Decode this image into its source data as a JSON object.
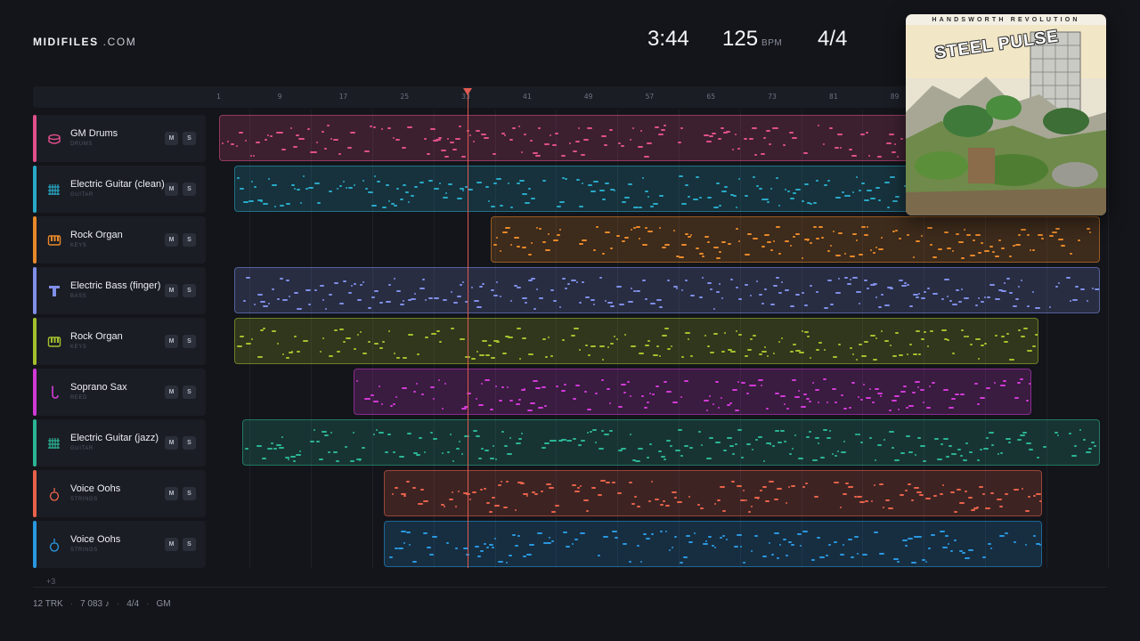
{
  "header": {
    "logo_bold": "MIDIFILES",
    "logo_light": ".COM",
    "duration": "3:44",
    "tempo": "125",
    "tempo_unit": "BPM",
    "time_signature": "4/4"
  },
  "album": {
    "title": "HANDSWORTH REVOLUTION",
    "band": "STEEL PULSE"
  },
  "ruler": {
    "ticks": [
      "1",
      "9",
      "17",
      "25",
      "33",
      "41",
      "49",
      "57",
      "65",
      "73",
      "81",
      "89"
    ]
  },
  "playhead_bar": 33.4,
  "tracks": [
    {
      "name": "GM Drums",
      "category": "DRUMS",
      "color": "#e0508a",
      "icon": "drum-icon",
      "clip_start_bar": 1,
      "clip_end_bar": 999,
      "mute_label": "M",
      "solo_label": "S"
    },
    {
      "name": "Electric Guitar (clean)",
      "category": "GUITAR",
      "color": "#29a9c8",
      "icon": "guitar-icon",
      "clip_start_bar": 3,
      "clip_end_bar": 999,
      "mute_label": "M",
      "solo_label": "S"
    },
    {
      "name": "Rock Organ",
      "category": "KEYS",
      "color": "#e8892a",
      "icon": "keys-icon",
      "clip_start_bar": 36.5,
      "clip_end_bar": 116,
      "mute_label": "M",
      "solo_label": "S"
    },
    {
      "name": "Electric Bass (finger)",
      "category": "BASS",
      "color": "#7f8fe8",
      "icon": "bass-icon",
      "clip_start_bar": 3,
      "clip_end_bar": 116,
      "mute_label": "M",
      "solo_label": "S"
    },
    {
      "name": "Rock Organ",
      "category": "KEYS",
      "color": "#a4c12d",
      "icon": "keys-icon",
      "clip_start_bar": 3,
      "clip_end_bar": 108,
      "mute_label": "M",
      "solo_label": "S"
    },
    {
      "name": "Soprano Sax",
      "category": "REED",
      "color": "#d23ad8",
      "icon": "sax-icon",
      "clip_start_bar": 18.5,
      "clip_end_bar": 107,
      "mute_label": "M",
      "solo_label": "S"
    },
    {
      "name": "Electric Guitar (jazz)",
      "category": "GUITAR",
      "color": "#2bb595",
      "icon": "guitar-icon",
      "clip_start_bar": 4,
      "clip_end_bar": 116,
      "mute_label": "M",
      "solo_label": "S"
    },
    {
      "name": "Voice Oohs",
      "category": "STRINGS",
      "color": "#e8624a",
      "icon": "violin-icon",
      "clip_start_bar": 22.5,
      "clip_end_bar": 108.5,
      "mute_label": "M",
      "solo_label": "S"
    },
    {
      "name": "Voice Oohs",
      "category": "STRINGS",
      "color": "#2a98e0",
      "icon": "violin-icon",
      "clip_start_bar": 22.5,
      "clip_end_bar": 108.5,
      "mute_label": "M",
      "solo_label": "S"
    }
  ],
  "more_tracks_label": "+3",
  "footer": {
    "tracks": "12 TRK",
    "notes": "7 083 ♪",
    "time_signature": "4/4",
    "standard": "GM"
  }
}
